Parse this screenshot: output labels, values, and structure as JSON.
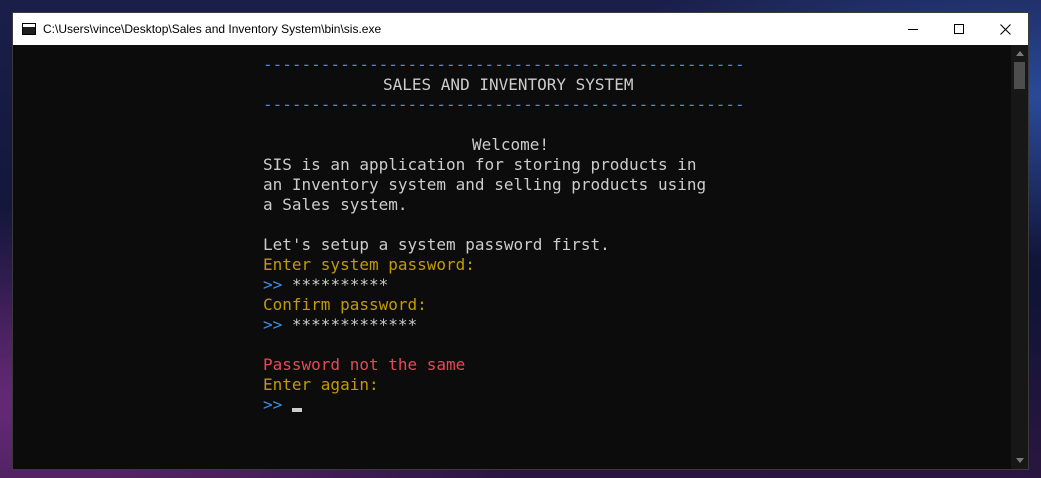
{
  "window": {
    "title": "C:\\Users\\vince\\Desktop\\Sales and Inventory System\\bin\\sis.exe"
  },
  "console": {
    "divider_top": "--------------------------------------------------",
    "header": "SALES AND INVENTORY SYSTEM",
    "divider_bottom": "--------------------------------------------------",
    "welcome": "Welcome!",
    "intro_1": "SIS is an application for storing products in",
    "intro_2": "an Inventory system and selling products using",
    "intro_3": "a Sales system.",
    "setup": "Let's setup a system password first.",
    "enter_password_prompt": "Enter system password:",
    "prompt_symbol": ">>",
    "password_1": "**********",
    "confirm_prompt": "Confirm password:",
    "password_2": "*************",
    "error": "Password not the same",
    "enter_again": "Enter again:",
    "prompt_symbol_final": ">>"
  },
  "colors": {
    "divider": "#3b8eea",
    "prompt": "#c19c00",
    "error": "#e74856",
    "text": "#cccccc",
    "background": "#0c0c0c"
  },
  "icons": {
    "app": "console-icon",
    "minimize": "minimize-icon",
    "maximize": "maximize-icon",
    "close": "close-icon"
  }
}
